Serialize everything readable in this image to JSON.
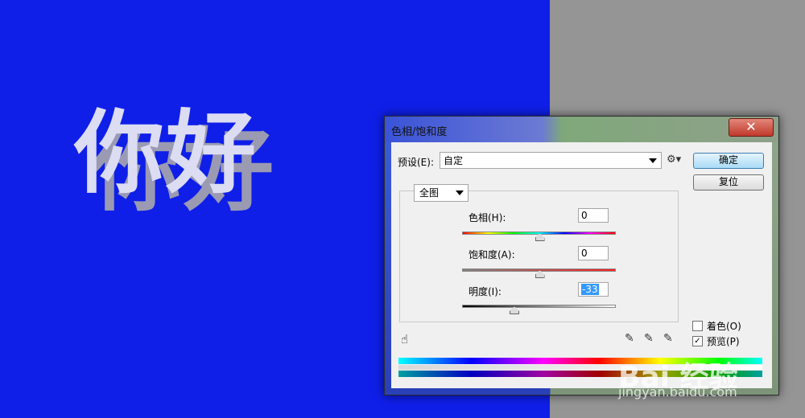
{
  "canvas": {
    "text": "你好",
    "colors": {
      "left": "#0f1fe8",
      "right": "#959595"
    }
  },
  "dialog": {
    "title": "色相/饱和度",
    "close_glyph": "✕",
    "preset": {
      "label": "预设(E):",
      "value": "自定"
    },
    "buttons": {
      "ok": "确定",
      "reset": "复位"
    },
    "channel": "全图",
    "sliders": [
      {
        "label": "色相(H):",
        "value": "0",
        "position": 0.5
      },
      {
        "label": "饱和度(A):",
        "value": "0",
        "position": 0.5
      },
      {
        "label": "明度(I):",
        "value": "-33",
        "position": 0.335
      }
    ],
    "colorize": {
      "label": "着色(O)",
      "checked": false
    },
    "preview": {
      "label": "预览(P)",
      "checked": true
    }
  },
  "watermark": {
    "logo": "Bai 经验",
    "url": "jingyan.baidu.com"
  }
}
